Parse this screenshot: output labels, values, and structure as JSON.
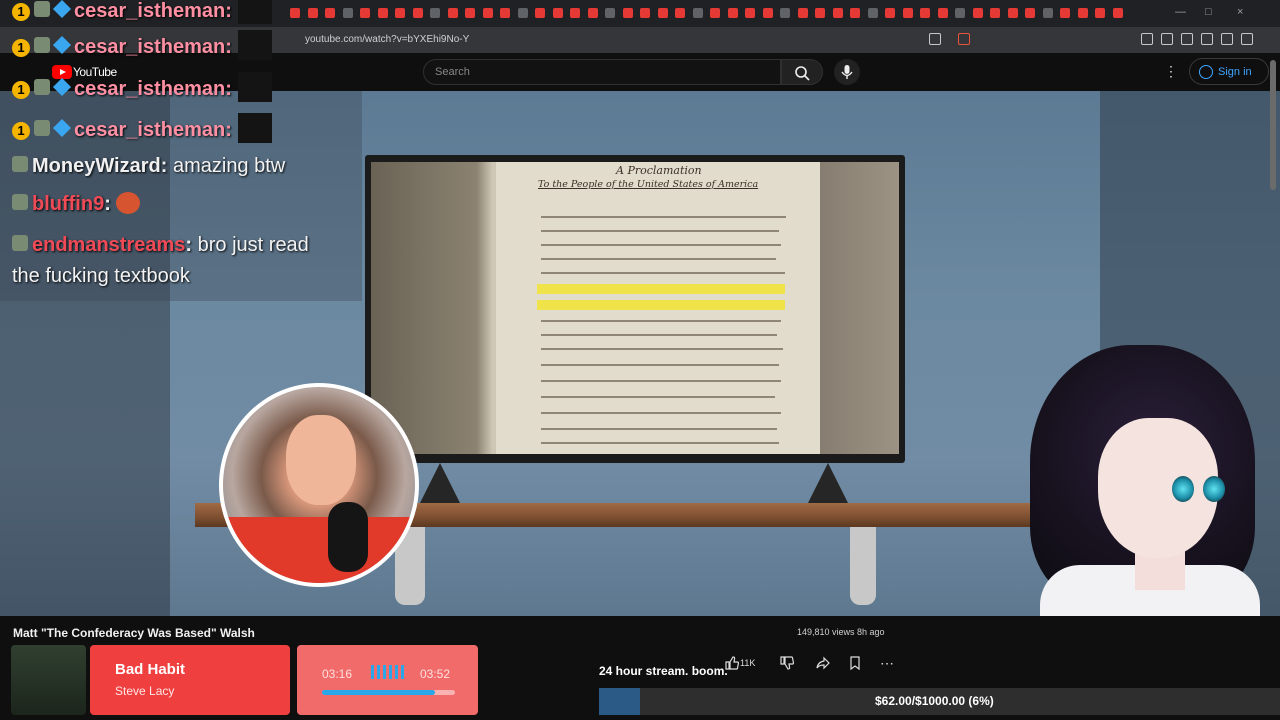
{
  "browser": {
    "url": "youtube.com/watch?v=bYXEhi9No-Y"
  },
  "youtube": {
    "logo_text": "YouTube",
    "search_placeholder": "Search",
    "sign_in_label": "Sign in",
    "video_title": "Matt \"The Confederacy Was Based\" Walsh",
    "views_and_age": "149,810 views  8h ago",
    "like_count": "11K"
  },
  "document": {
    "heading": "A Proclamation",
    "subheading": "To the People of the United States of America"
  },
  "chat": {
    "messages": [
      {
        "user": "cesar_istheman",
        "sep": ":",
        "text": ""
      },
      {
        "user": "cesar_istheman",
        "sep": ":",
        "text": ""
      },
      {
        "user": "cesar_istheman",
        "sep": ":",
        "text": ""
      },
      {
        "user": "cesar_istheman",
        "sep": ":",
        "text": ""
      },
      {
        "user": "MoneyWizard",
        "sep": ":",
        "text": " amazing btw"
      },
      {
        "user": "bluffin9",
        "sep": ":",
        "text": ""
      },
      {
        "user": "endmanstreams",
        "sep": ":",
        "text": " bro just read"
      }
    ],
    "wrap_text": "the fucking textbook"
  },
  "now_playing": {
    "song": "Bad Habit",
    "artist": "Steve Lacy",
    "current_time": "03:16",
    "total_time": "03:52",
    "progress_fraction": 0.85
  },
  "stream": {
    "message": "24 hour stream. boom.",
    "goal_text": "$62.00/$1000.00 (6%)",
    "goal_fraction": 0.06
  },
  "colors": {
    "youtube_red": "#ff0000",
    "link_blue": "#3ea6ff",
    "now_playing_red": "#ef3f3f",
    "goal_blue": "#2b5a86"
  }
}
